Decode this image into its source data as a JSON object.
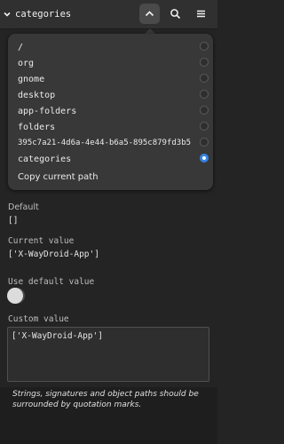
{
  "header": {
    "path_label": "categories",
    "icons": [
      "chevron-down-icon",
      "chevron-up-icon",
      "search-icon",
      "menu-icon"
    ]
  },
  "popover": {
    "items": [
      {
        "label": "/",
        "checked": false
      },
      {
        "label": "org",
        "checked": false
      },
      {
        "label": "gnome",
        "checked": false
      },
      {
        "label": "desktop",
        "checked": false
      },
      {
        "label": "app-folders",
        "checked": false
      },
      {
        "label": "folders",
        "checked": false
      },
      {
        "label": "395c7a21-4d6a-4e44-b6a5-895c879fd3b5",
        "checked": false
      },
      {
        "label": "categories",
        "checked": true
      }
    ],
    "copy_label": "Copy current path"
  },
  "default": {
    "label": "Default",
    "value": "[]"
  },
  "current": {
    "label": "Current value",
    "value": "['X-WayDroid-App']"
  },
  "use_default": {
    "label": "Use default value",
    "state": "off"
  },
  "custom": {
    "label": "Custom value",
    "value": "['X-WayDroid-App']"
  },
  "hint": "Strings, signatures and object paths should be surrounded by quotation marks.",
  "colors": {
    "accent": "#3584e4",
    "background": "#242424",
    "popover": "#383838"
  }
}
